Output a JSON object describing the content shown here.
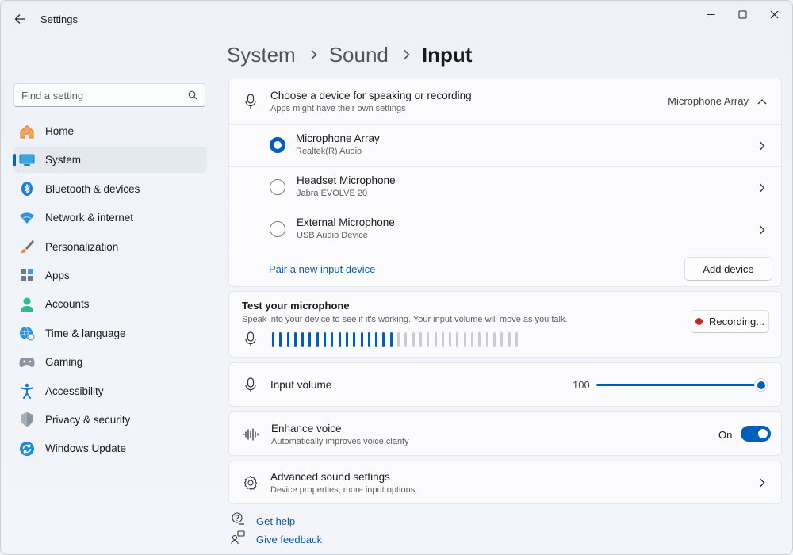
{
  "window": {
    "app_title": "Settings",
    "controls": {
      "minimize": "minimize",
      "maximize": "maximize",
      "close": "close"
    }
  },
  "breadcrumb": [
    "System",
    "Sound",
    "Input"
  ],
  "search": {
    "placeholder": "Find a setting"
  },
  "sidebar": {
    "items": [
      {
        "label": "Home",
        "icon": "home-icon",
        "active": false
      },
      {
        "label": "System",
        "icon": "system-icon",
        "active": true
      },
      {
        "label": "Bluetooth & devices",
        "icon": "bluetooth-icon",
        "active": false
      },
      {
        "label": "Network & internet",
        "icon": "wifi-icon",
        "active": false
      },
      {
        "label": "Personalization",
        "icon": "brush-icon",
        "active": false
      },
      {
        "label": "Apps",
        "icon": "apps-icon",
        "active": false
      },
      {
        "label": "Accounts",
        "icon": "account-icon",
        "active": false
      },
      {
        "label": "Time & language",
        "icon": "globe-clock-icon",
        "active": false
      },
      {
        "label": "Gaming",
        "icon": "gamepad-icon",
        "active": false
      },
      {
        "label": "Accessibility",
        "icon": "accessibility-icon",
        "active": false
      },
      {
        "label": "Privacy & security",
        "icon": "shield-icon",
        "active": false
      },
      {
        "label": "Windows Update",
        "icon": "update-icon",
        "active": false
      }
    ]
  },
  "device_chooser": {
    "title": "Choose a device for speaking or recording",
    "subtitle": "Apps might have their own settings",
    "selected_value": "Microphone Array",
    "devices": [
      {
        "name": "Microphone Array",
        "detail": "Realtek(R) Audio",
        "selected": true
      },
      {
        "name": "Headset Microphone",
        "detail": "Jabra EVOLVE 20",
        "selected": false
      },
      {
        "name": "External Microphone",
        "detail": "USB Audio Device",
        "selected": false
      }
    ],
    "pair_link": "Pair a new input device",
    "add_button": "Add device"
  },
  "test_mic": {
    "title": "Test your microphone",
    "description": "Speak into your device to see if it's working. Your input volume will move as you talk.",
    "recording_button": "Recording...",
    "meter_active_bars": 17,
    "meter_total_bars": 34
  },
  "input_volume": {
    "label": "Input volume",
    "value": "100",
    "level": 1.0
  },
  "enhance_voice": {
    "title": "Enhance voice",
    "subtitle": "Automatically improves voice clarity",
    "state_label": "On",
    "on": true
  },
  "advanced": {
    "title": "Advanced sound settings",
    "subtitle": "Device properties, more input options"
  },
  "help": {
    "get_help": "Get help",
    "give_feedback": "Give feedback"
  },
  "colors": {
    "accent": "#005fb8",
    "meter_inactive": "#c8cdd4",
    "record_dot": "#c42b1c"
  }
}
